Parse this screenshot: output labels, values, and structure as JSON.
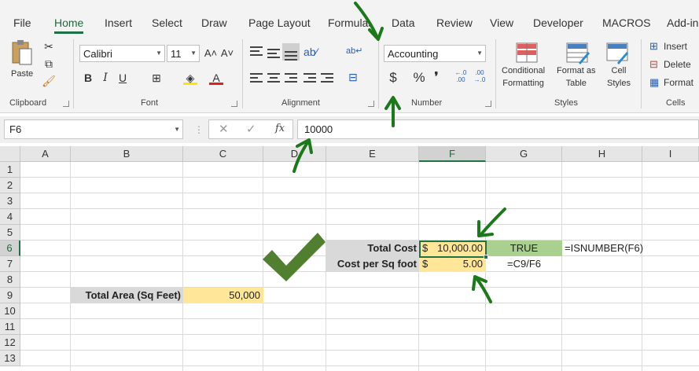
{
  "tabs": [
    "File",
    "Home",
    "Insert",
    "Select",
    "Draw",
    "Page Layout",
    "Formulas",
    "Data",
    "Review",
    "View",
    "Developer",
    "MACROS",
    "Add-ins"
  ],
  "ribbon": {
    "clipboard": {
      "paste": "Paste",
      "label": "Clipboard"
    },
    "font": {
      "name": "Calibri",
      "size": "11",
      "grow": "A˄",
      "shrink": "A˅",
      "bold": "B",
      "italic": "I",
      "underline": "U",
      "color_letter": "A",
      "label": "Font"
    },
    "alignment": {
      "label": "Alignment"
    },
    "number": {
      "format": "Accounting",
      "currency": "$",
      "percent": "%",
      "comma": "ટ",
      "inc": "←.0\n.00",
      "dec": ".00\n→.0",
      "label": "Number"
    },
    "styles": {
      "conditional": "Conditional\nFormatting",
      "format_table": "Format as\nTable",
      "cell_styles": "Cell\nStyles",
      "label": "Styles"
    },
    "cells": {
      "insert": "Insert",
      "delete": "Delete",
      "format": "Format",
      "label": "Cells"
    }
  },
  "formula_bar": {
    "name_box": "F6",
    "cancel": "✕",
    "enter": "✓",
    "fx": "fx",
    "value": "10000"
  },
  "columns": [
    "A",
    "B",
    "C",
    "D",
    "E",
    "F",
    "G",
    "H",
    "I"
  ],
  "rows": [
    "1",
    "2",
    "3",
    "4",
    "5",
    "6",
    "7",
    "8",
    "9",
    "10",
    "11",
    "12",
    "13"
  ],
  "cells": {
    "e6": "Total Cost",
    "f6_symbol": "$",
    "f6_value": "10,000.00",
    "g6": "TRUE",
    "h6": "=ISNUMBER(F6)",
    "e7": "Cost per Sq foot",
    "f7_symbol": "$",
    "f7_value": "5.00",
    "g7": "=C9/F6",
    "b9": "Total Area (Sq Feet)",
    "c9": "50,000"
  },
  "colors": {
    "accent": "#217346",
    "annotation_green": "#1a7a1a",
    "check_green": "#4f7f2f",
    "yellow_fill": "#ffe699",
    "grey_fill": "#d9d9d9",
    "true_fill": "#a9d08e"
  }
}
